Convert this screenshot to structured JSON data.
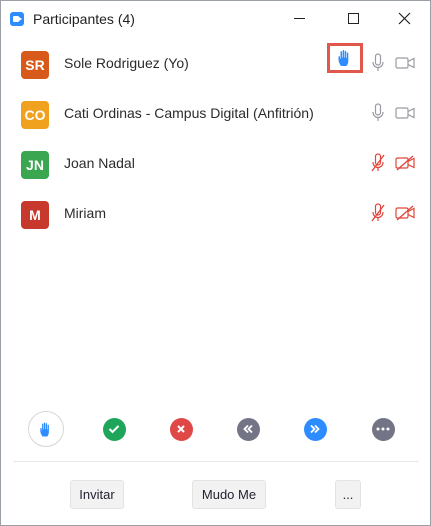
{
  "window": {
    "title": "Participantes (4)"
  },
  "participants": [
    {
      "initials": "SR",
      "name": "Sole Rodriguez (Yo)",
      "color": "#d85a1a",
      "hand_raised": true,
      "muted": false,
      "video_off": false
    },
    {
      "initials": "CO",
      "name": "Cati Ordinas - Campus Digital (Anfitrión)",
      "color": "#f0a21e",
      "hand_raised": false,
      "muted": false,
      "video_off": false
    },
    {
      "initials": "JN",
      "name": "Joan Nadal",
      "color": "#3aa650",
      "hand_raised": false,
      "muted": true,
      "video_off": true
    },
    {
      "initials": "M",
      "name": "Miriam",
      "color": "#c8392d",
      "hand_raised": false,
      "muted": true,
      "video_off": true
    }
  ],
  "reactions": [
    "raise-hand-icon",
    "yes-icon",
    "no-icon",
    "slower-icon",
    "faster-icon",
    "more-icon"
  ],
  "colors": {
    "accent": "#2d8cff",
    "muted": "#e0453a",
    "yes": "#1fa55a",
    "no": "#e04848",
    "neutral": "#747487",
    "highlight": "#e2574c"
  },
  "footer": {
    "invite_label": "Invitar",
    "mute_me_label": "Mudo Me",
    "more_label": "..."
  }
}
